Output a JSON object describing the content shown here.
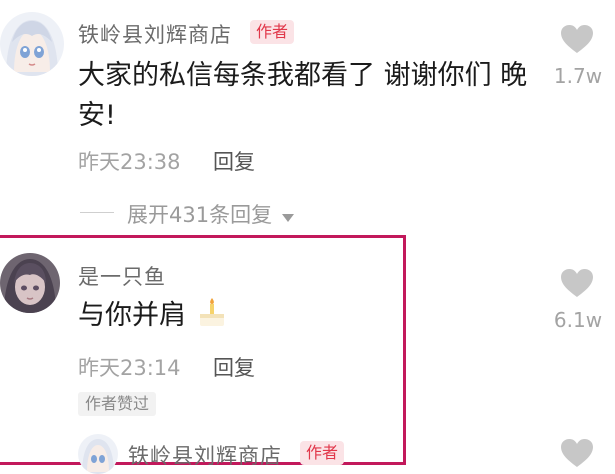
{
  "comment_main": {
    "username": "铁岭县刘辉商店",
    "badge": "作者",
    "text": "大家的私信每条我都看了 谢谢你们 晚安!",
    "time": "昨天23:38",
    "reply_label": "回复",
    "like_count": "1.7w",
    "expand_label": "展开431条回复",
    "expand_icon": "triangle-down-icon"
  },
  "reply_1": {
    "username": "是一只鱼",
    "text": "与你并肩",
    "time": "昨天23:14",
    "reply_label": "回复",
    "like_count": "6.1w",
    "liked_tag": "作者赞过",
    "emoji": "cake-emoji"
  },
  "reply_2": {
    "username": "铁岭县刘辉商店",
    "badge": "作者"
  },
  "colors": {
    "highlight_border": "#c2185b",
    "badge_text": "#e1374a",
    "badge_bg": "#fbe3e6"
  }
}
